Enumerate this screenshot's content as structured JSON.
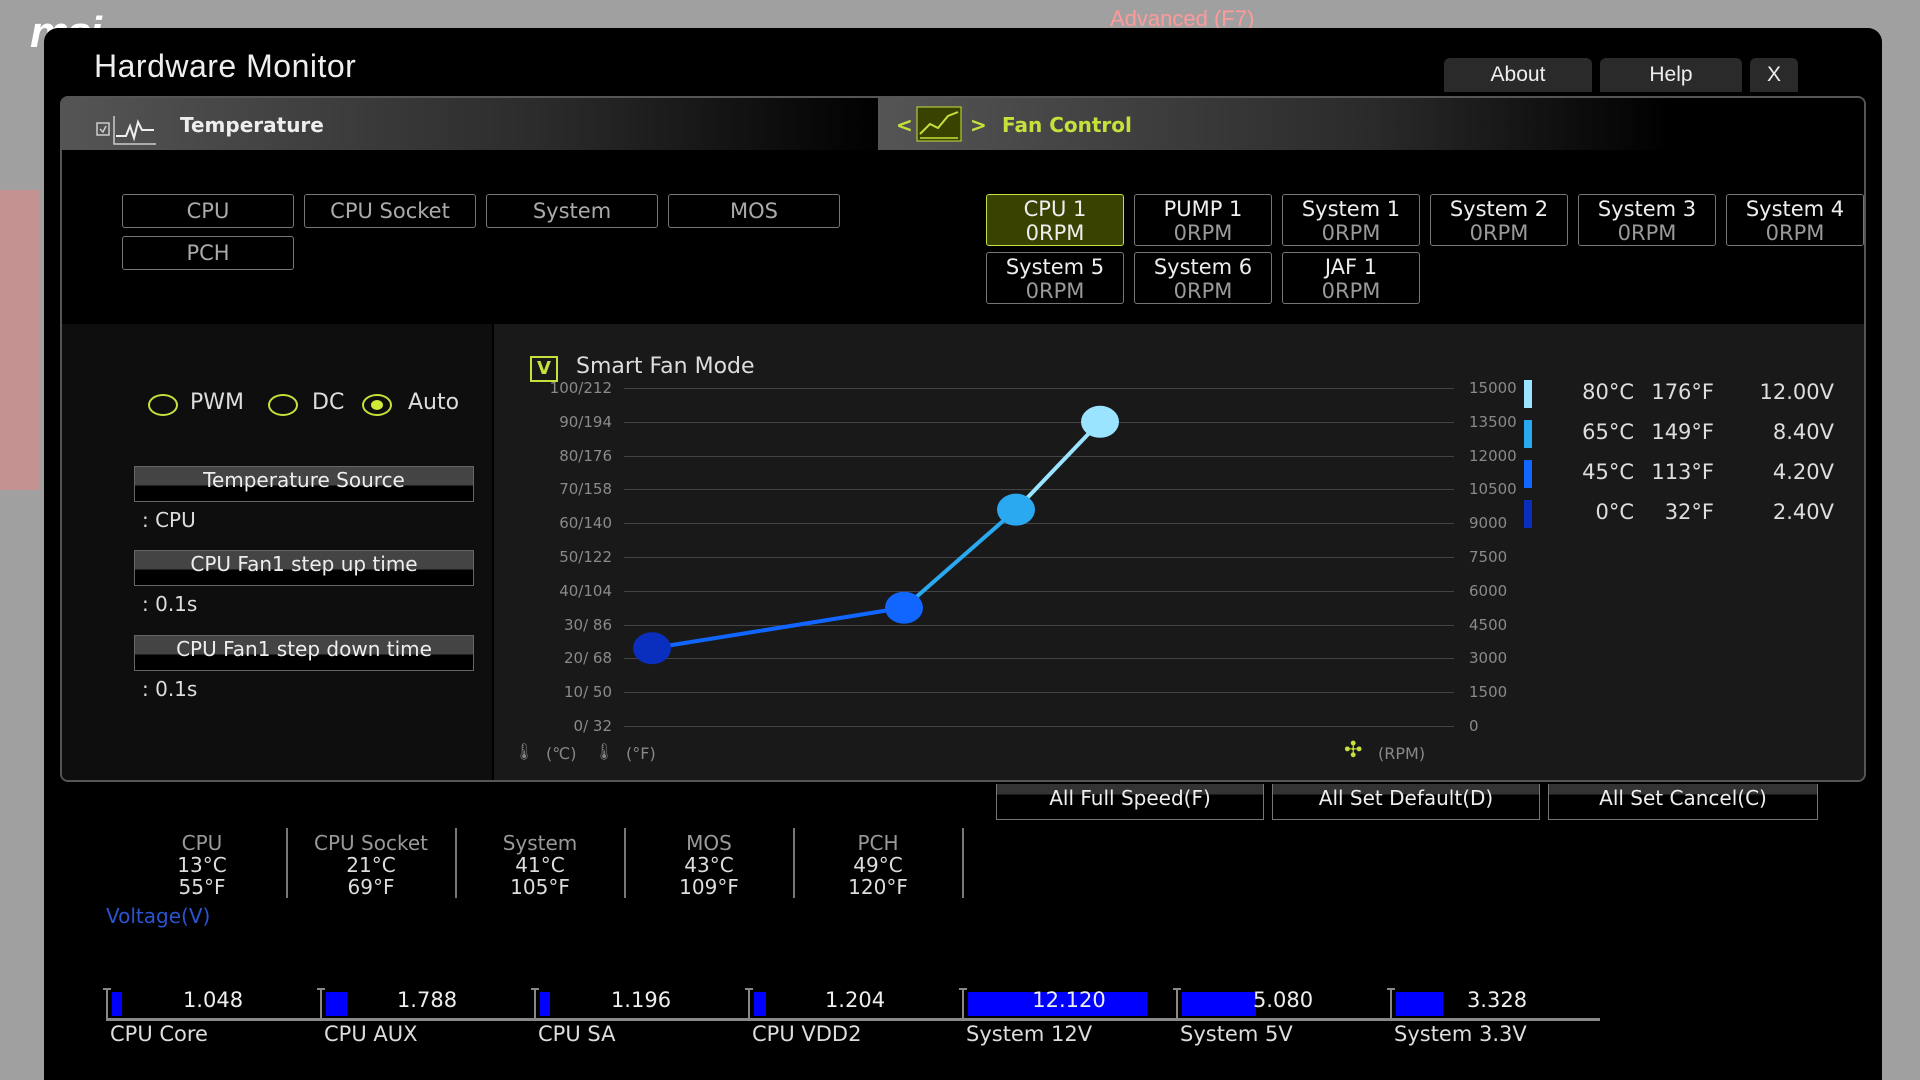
{
  "background": {
    "brand": "msi",
    "tab_advanced": "Advanced (F7)"
  },
  "window": {
    "title": "Hardware Monitor",
    "buttons": {
      "about": "About",
      "help": "Help",
      "close": "X"
    }
  },
  "temperature": {
    "header": "Temperature",
    "sources": [
      {
        "label": "CPU",
        "active": true
      },
      {
        "label": "CPU Socket",
        "active": false
      },
      {
        "label": "System",
        "active": false
      },
      {
        "label": "MOS",
        "active": false
      },
      {
        "label": "PCH",
        "active": false
      }
    ]
  },
  "fan_control": {
    "header": "Fan Control",
    "nav_prev": "<",
    "nav_next": ">",
    "fans": [
      {
        "name": "CPU 1",
        "rpm": "0RPM",
        "active": true
      },
      {
        "name": "PUMP 1",
        "rpm": "0RPM",
        "active": false
      },
      {
        "name": "System 1",
        "rpm": "0RPM",
        "active": false
      },
      {
        "name": "System 2",
        "rpm": "0RPM",
        "active": false
      },
      {
        "name": "System 3",
        "rpm": "0RPM",
        "active": false
      },
      {
        "name": "System 4",
        "rpm": "0RPM",
        "active": false
      },
      {
        "name": "System 5",
        "rpm": "0RPM",
        "active": false
      },
      {
        "name": "System 6",
        "rpm": "0RPM",
        "active": false
      },
      {
        "name": "JAF 1",
        "rpm": "0RPM",
        "active": false
      }
    ]
  },
  "mode": {
    "options": [
      "PWM",
      "DC",
      "Auto"
    ],
    "selected": "Auto"
  },
  "settings": {
    "temp_source_label": "Temperature Source",
    "temp_source_value": ": CPU",
    "step_up_label": "CPU Fan1 step up time",
    "step_up_value": ": 0.1s",
    "step_down_label": "CPU Fan1 step down time",
    "step_down_value": ": 0.1s"
  },
  "smart_fan": {
    "label": "Smart Fan Mode",
    "checked": true,
    "check_glyph": "V"
  },
  "chart_data": {
    "type": "line",
    "title": "Smart Fan Mode",
    "xlabel": "",
    "ylabel_left": "(°C) / (°F)",
    "ylabel_right": "(RPM)",
    "y_left_ticks": [
      "100/212",
      "90/194",
      "80/176",
      "70/158",
      "60/140",
      "50/122",
      "40/104",
      "30/ 86",
      "20/ 68",
      "10/ 50",
      "0/ 32"
    ],
    "y_right_ticks": [
      "15000",
      "13500",
      "12000",
      "10500",
      "9000",
      "7500",
      "6000",
      "4500",
      "3000",
      "1500",
      "0"
    ],
    "unit_labels": {
      "celsius": "(℃)",
      "fahrenheit": "(°F)",
      "rpm": "(RPM)"
    },
    "ylim": [
      0,
      100
    ],
    "points": [
      {
        "temp_c": 0,
        "temp_f": 32,
        "voltage": "2.40V",
        "y_level": 23,
        "color": "#0a2fbf"
      },
      {
        "temp_c": 45,
        "temp_f": 113,
        "voltage": "4.20V",
        "y_level": 35,
        "color": "#1066ff"
      },
      {
        "temp_c": 65,
        "temp_f": 149,
        "voltage": "8.40V",
        "y_level": 64,
        "color": "#2aa8f0"
      },
      {
        "temp_c": 80,
        "temp_f": 176,
        "voltage": "12.00V",
        "y_level": 90,
        "color": "#9ae4ff"
      }
    ],
    "legend": [
      {
        "c": "80°C",
        "f": "176°F",
        "v": "12.00V",
        "color": "#9ae4ff"
      },
      {
        "c": "65°C",
        "f": "149°F",
        "v": "8.40V",
        "color": "#2aa8f0"
      },
      {
        "c": "45°C",
        "f": "113°F",
        "v": "4.20V",
        "color": "#1066ff"
      },
      {
        "c": "0°C",
        "f": "32°F",
        "v": "2.40V",
        "color": "#0a2fbf"
      }
    ]
  },
  "actions": {
    "full_speed": "All Full Speed(F)",
    "set_default": "All Set Default(D)",
    "set_cancel": "All Set Cancel(C)"
  },
  "readings": [
    {
      "name": "CPU",
      "c": "13°C",
      "f": "55°F"
    },
    {
      "name": "CPU Socket",
      "c": "21°C",
      "f": "69°F"
    },
    {
      "name": "System",
      "c": "41°C",
      "f": "105°F"
    },
    {
      "name": "MOS",
      "c": "43°C",
      "f": "109°F"
    },
    {
      "name": "PCH",
      "c": "49°C",
      "f": "120°F"
    }
  ],
  "voltage": {
    "label": "Voltage(V)",
    "items": [
      {
        "name": "CPU Core",
        "value": "1.048",
        "fill": 0.05
      },
      {
        "name": "CPU AUX",
        "value": "1.788",
        "fill": 0.1
      },
      {
        "name": "CPU SA",
        "value": "1.196",
        "fill": 0.05
      },
      {
        "name": "CPU VDD2",
        "value": "1.204",
        "fill": 0.06
      },
      {
        "name": "System 12V",
        "value": "12.120",
        "fill": 0.87
      },
      {
        "name": "System 5V",
        "value": "5.080",
        "fill": 0.36
      },
      {
        "name": "System 3.3V",
        "value": "3.328",
        "fill": 0.23
      }
    ]
  },
  "colors": {
    "accent": "#c8e03c",
    "voltage_fill": "#0000ff",
    "voltage_label": "#2a54d0"
  }
}
